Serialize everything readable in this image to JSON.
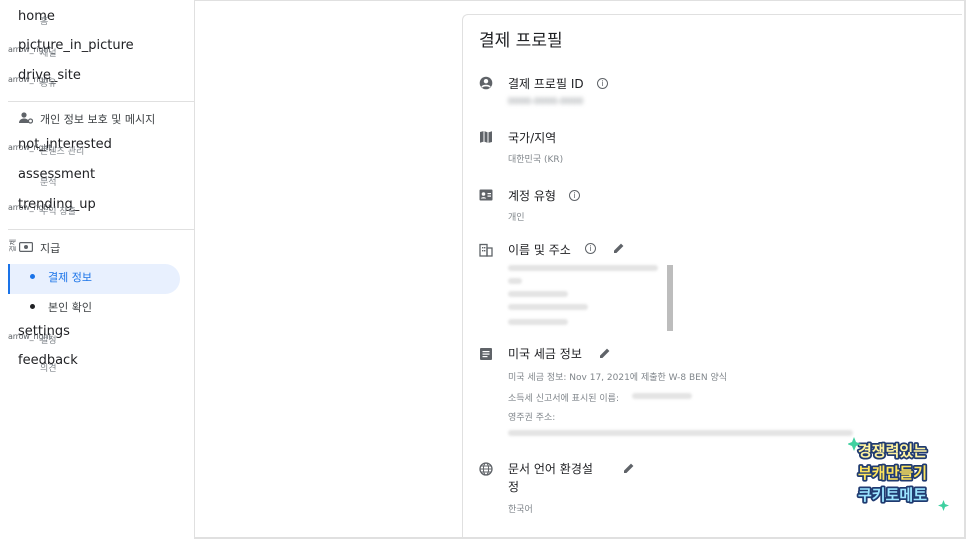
{
  "sidebar": {
    "ligatures": {
      "home": "home",
      "pip": "picture_in_picture",
      "drive": "drive_site",
      "not_interested": "not_interested",
      "assessment": "assessment",
      "trending": "trending_up",
      "settings": "settings",
      "feedback": "feedback"
    },
    "arrow_ligature": "arrow_right",
    "arrow_ligature_short": "arrow_right_",
    "overlaps": {
      "home": "홈",
      "pip": "채널",
      "drive": "공유",
      "not_interested": "콘텐츠 관리",
      "assessment": "분석",
      "trending": "수익 창출",
      "settings": "설정",
      "feedback": "의견"
    },
    "privacy_label": "개인 정보 보호 및 메시지",
    "payment_vertical": "결제",
    "payment_label": "지급",
    "payment_info_label": "결제 정보",
    "identity_label": "본인 확인"
  },
  "card": {
    "title": "결제 프로필",
    "sections": {
      "profile_id": {
        "label": "결제 프로필 ID",
        "value": "0000-0000-0000"
      },
      "country": {
        "label": "국가/지역",
        "value": "대한민국 (KR)"
      },
      "account_type": {
        "label": "계정 유형",
        "value": "개인"
      },
      "name_address": {
        "label": "이름 및 주소"
      },
      "us_tax": {
        "label": "미국 세금 정보",
        "line1": "미국 세금 정보: Nov 17, 2021에 제출한 W-8 BEN 양식",
        "line2": "소득세 신고서에 표시된 이름:",
        "line3": "영주권 주소:"
      },
      "doc_language": {
        "label_line1": "문서 언어 환경설",
        "label_line2": "정",
        "value": "한국어"
      }
    }
  },
  "watermark": {
    "line1": "경쟁력있는",
    "line2": "부캐만들기",
    "line3": "쿠키토메토"
  },
  "colors": {
    "accent": "#1a73e8",
    "active_bg": "#e8f0fe",
    "text": "#3c4043"
  }
}
